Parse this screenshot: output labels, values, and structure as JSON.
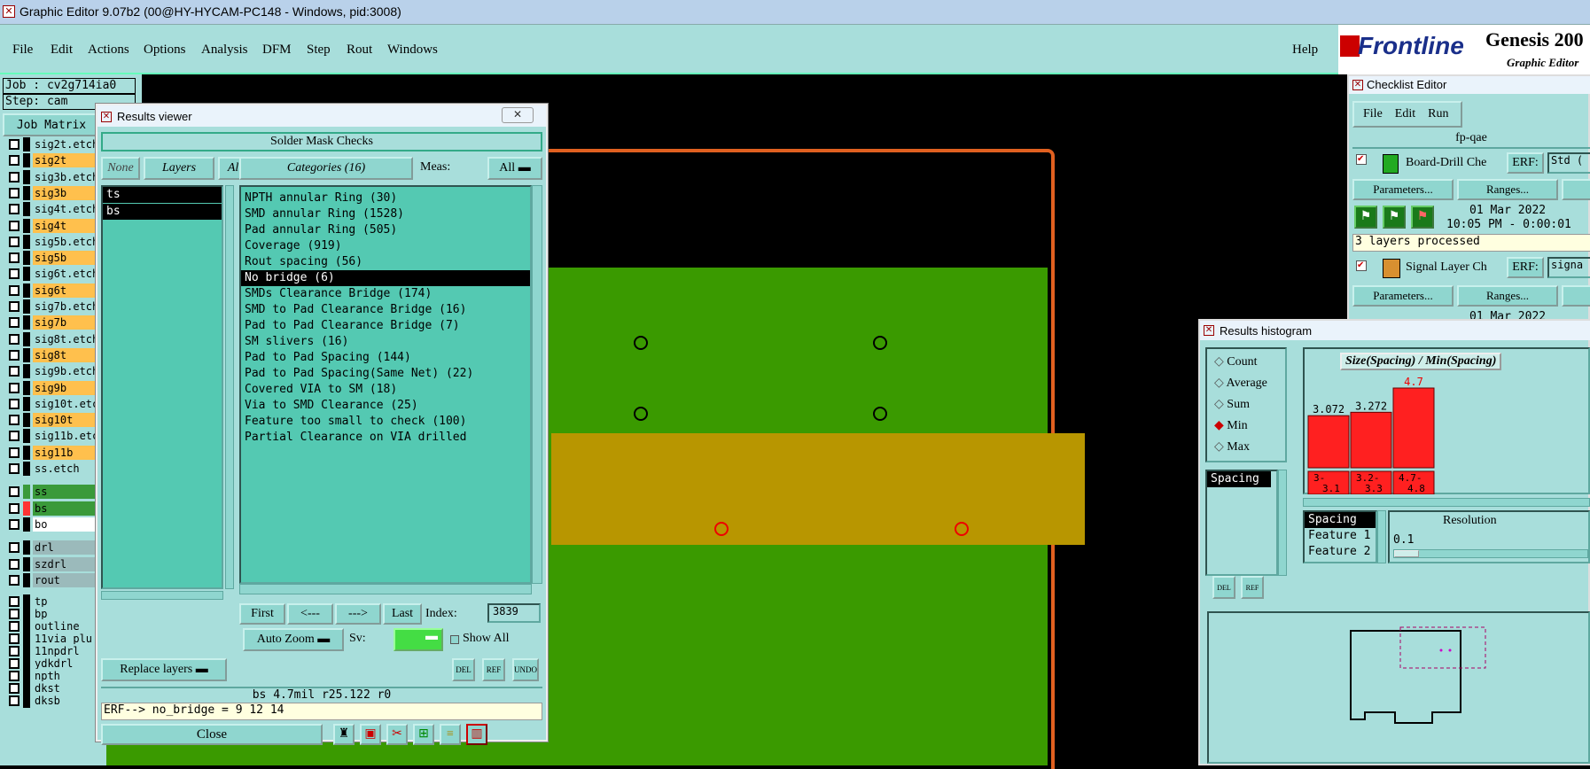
{
  "app": {
    "title": "Graphic Editor 9.07b2 (00@HY-HYCAM-PC148 - Windows, pid:3008)"
  },
  "menu": [
    "File",
    "Edit",
    "Actions",
    "Options",
    "Analysis",
    "DFM",
    "Step",
    "Rout",
    "Windows"
  ],
  "help": "Help",
  "brand": {
    "logo": "Frontline",
    "product": "Genesis 200",
    "sub": "Graphic Editor"
  },
  "job": {
    "job_label": "Job : cv2g714ia0",
    "step_label": "Step: cam",
    "job_matrix": "Job Matrix"
  },
  "layers": [
    {
      "name": "sig2t.etch",
      "color": "#a8dedb"
    },
    {
      "name": "sig2t",
      "color": "#ffc04d"
    },
    {
      "name": "sig3b.etch",
      "color": "#a8dedb"
    },
    {
      "name": "sig3b",
      "color": "#ffc04d"
    },
    {
      "name": "sig4t.etch",
      "color": "#a8dedb"
    },
    {
      "name": "sig4t",
      "color": "#ffc04d"
    },
    {
      "name": "sig5b.etch",
      "color": "#a8dedb"
    },
    {
      "name": "sig5b",
      "color": "#ffc04d"
    },
    {
      "name": "sig6t.etch",
      "color": "#a8dedb"
    },
    {
      "name": "sig6t",
      "color": "#ffc04d"
    },
    {
      "name": "sig7b.etch",
      "color": "#a8dedb"
    },
    {
      "name": "sig7b",
      "color": "#ffc04d"
    },
    {
      "name": "sig8t.etch",
      "color": "#a8dedb"
    },
    {
      "name": "sig8t",
      "color": "#ffc04d"
    },
    {
      "name": "sig9b.etch",
      "color": "#a8dedb"
    },
    {
      "name": "sig9b",
      "color": "#ffc04d"
    },
    {
      "name": "sig10t.etch",
      "color": "#a8dedb"
    },
    {
      "name": "sig10t",
      "color": "#ffc04d"
    },
    {
      "name": "sig11b.etch",
      "color": "#a8dedb"
    },
    {
      "name": "sig11b",
      "color": "#ffc04d"
    },
    {
      "name": "ss.etch",
      "color": "#a8dedb"
    }
  ],
  "layers2": [
    {
      "name": "ss",
      "color": "#3a9a3a",
      "sw": "#3a9a3a"
    },
    {
      "name": "bs",
      "color": "#3a9a3a",
      "sw": "#ff3333"
    },
    {
      "name": "bo",
      "color": "#ffffff",
      "sw": "#000000"
    }
  ],
  "layers3": [
    "drl",
    "szdrl",
    "rout"
  ],
  "layers4": [
    "tp",
    "bp",
    "outline",
    "11via_plu",
    "11npdrl",
    "ydkdrl",
    "npth",
    "dkst",
    "dksb"
  ],
  "rv": {
    "title": "Results viewer",
    "header": "Solder Mask Checks",
    "none": "None",
    "layers": "Layers",
    "all": "All",
    "categories_btn": "Categories (16)",
    "meas_label": "Meas:",
    "meas_value": "All",
    "layer_items": [
      "ts",
      "bs"
    ],
    "categories": [
      "NPTH annular Ring (30)",
      "SMD annular Ring (1528)",
      "Pad annular Ring (505)",
      "Coverage (919)",
      "Rout spacing (56)",
      "No bridge (6)",
      "SMDs Clearance Bridge (174)",
      "SMD to Pad Clearance Bridge (16)",
      "Pad to Pad Clearance Bridge (7)",
      "SM slivers (16)",
      "Pad to Pad Spacing (144)",
      "Pad to Pad Spacing(Same Net) (22)",
      "Covered VIA to SM (18)",
      "Via to SMD Clearance (25)",
      "Feature too small to check (100)",
      "Partial Clearance on VIA drilled"
    ],
    "selected_category": 5,
    "nav": {
      "first": "First",
      "prev": "<---",
      "next": "--->",
      "last": "Last",
      "index_label": "Index:",
      "index_value": "3839"
    },
    "auto_zoom": "Auto Zoom",
    "sv": "Sv:",
    "show_all": "Show All",
    "replace_layers": "Replace layers",
    "del": "DEL",
    "ref": "REF",
    "undo": "UNDO",
    "status": "bs 4.7mil  r25.122  r0",
    "erf": "ERF--> no_bridge = 9 12 14",
    "close": "Close"
  },
  "ce": {
    "title": "Checklist Editor",
    "menu": [
      "File",
      "Edit",
      "Run"
    ],
    "name": "fp-qae",
    "check1": {
      "label": "Board-Drill Che",
      "erf": "ERF:",
      "erf_val": "Std (",
      "params": "Parameters...",
      "ranges": "Ranges...",
      "date": "01 Mar 2022",
      "time": "10:05 PM - 0:00:01",
      "msg": "3 layers processed"
    },
    "check2": {
      "label": "Signal Layer Ch",
      "erf": "ERF:",
      "erf_val": "signa",
      "params": "Parameters...",
      "ranges": "Ranges...",
      "date": "01 Mar 2022"
    }
  },
  "hist": {
    "title": "Results histogram",
    "options": [
      "Count",
      "Average",
      "Sum",
      "Min",
      "Max"
    ],
    "selected": "Min",
    "chart_title": "Size(Spacing) / Min(Spacing)",
    "list_item": "Spacing",
    "del": "DEL",
    "ref": "REF",
    "resolution_label": "Resolution",
    "resolution_value": "0.1",
    "fields": [
      "Spacing",
      "Feature 1",
      "Feature 2"
    ]
  },
  "chart_data": {
    "type": "bar",
    "title": "Size(Spacing) / Min(Spacing)",
    "categories": [
      "3-3.1",
      "3.2-3.3",
      "4.7-4.8"
    ],
    "values": [
      3.072,
      3.272,
      4.7
    ],
    "value_labels": [
      "3.072",
      "3.272",
      "4.7"
    ],
    "bar_labels": [
      [
        "3-",
        "3.1"
      ],
      [
        "3.2-",
        "3.3"
      ],
      [
        "4.7-",
        "4.8"
      ]
    ]
  }
}
